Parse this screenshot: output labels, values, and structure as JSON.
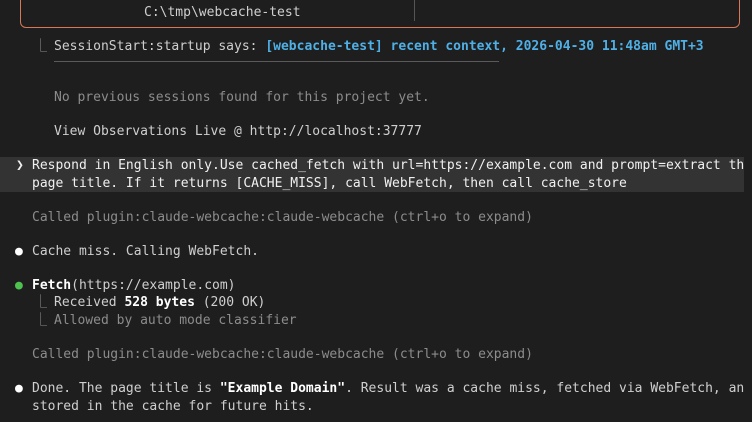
{
  "header": {
    "path": "C:\\tmp\\webcache-test"
  },
  "session": {
    "connector": "⎿",
    "prefix": "SessionStart:startup says: ",
    "highlight": "[webcache-test] recent context, 2026-04-30 11:48am GMT+3",
    "no_sessions": "No previous sessions found for this project yet.",
    "observations": "View Observations Live @ http://localhost:37777"
  },
  "prompt": {
    "marker": "❯",
    "line1": "Respond in English only.Use cached_fetch with url=https://example.com and prompt=extract the",
    "line2": "page title. If it returns [CACHE_MISS], call WebFetch, then call cache_store"
  },
  "transcript": {
    "called_1": "Called plugin:claude-webcache:claude-webcache (ctrl+o to expand)",
    "bullet": "●",
    "cache_miss": "Cache miss. Calling WebFetch.",
    "fetch_name": "Fetch",
    "fetch_args": "(https://example.com)",
    "connector": "⎿",
    "received_prefix": "Received ",
    "received_bytes": "528 bytes",
    "received_suffix": " (200 OK)",
    "allowed": "Allowed by auto mode classifier",
    "called_2": "Called plugin:claude-webcache:claude-webcache (ctrl+o to expand)",
    "done_prefix": "Done. The page title is ",
    "done_title": "\"Example Domain\"",
    "done_suffix": ". Result was a cache miss, fetched via WebFetch, and",
    "done_line2": "stored in the cache for future hits."
  },
  "colors": {
    "accent_border": "#d77757",
    "highlight": "#4fb0e6",
    "success_bullet": "#4ec24e"
  }
}
